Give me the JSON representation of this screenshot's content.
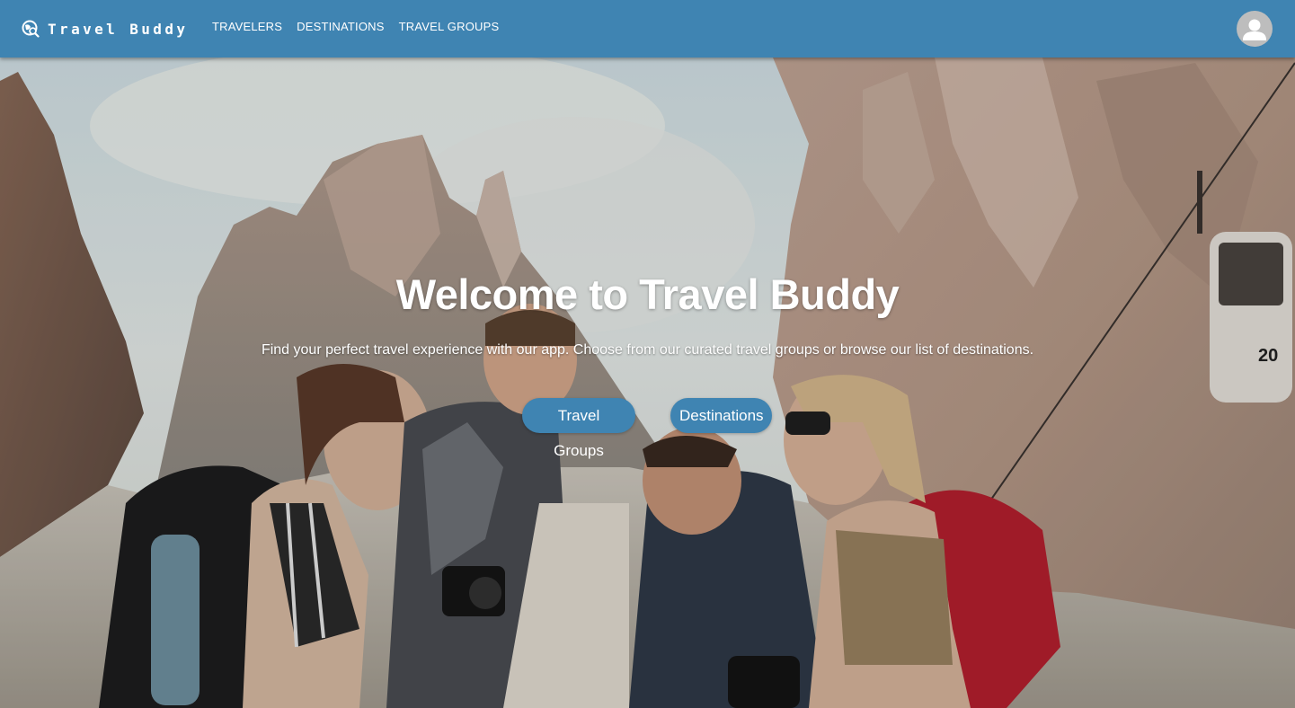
{
  "navbar": {
    "brand_name": "Travel Buddy",
    "brand_icon": "globe-search-icon",
    "links": [
      {
        "label": "TRAVELERS"
      },
      {
        "label": "DESTINATIONS"
      },
      {
        "label": "TRAVEL GROUPS"
      }
    ],
    "avatar_icon": "user-avatar-icon"
  },
  "hero": {
    "title": "Welcome to Travel Buddy",
    "subtitle": "Find your perfect travel experience with our app. Choose from our curated travel groups or browse our list of destinations.",
    "buttons": [
      {
        "label": "Travel Groups"
      },
      {
        "label": "Destinations"
      }
    ],
    "background": "photo-friends-hiking-mountains",
    "cable_car_number": "20"
  },
  "colors": {
    "primary": "#3f84b2",
    "on_primary": "#ffffff",
    "avatar_bg": "#bdbdbd"
  }
}
